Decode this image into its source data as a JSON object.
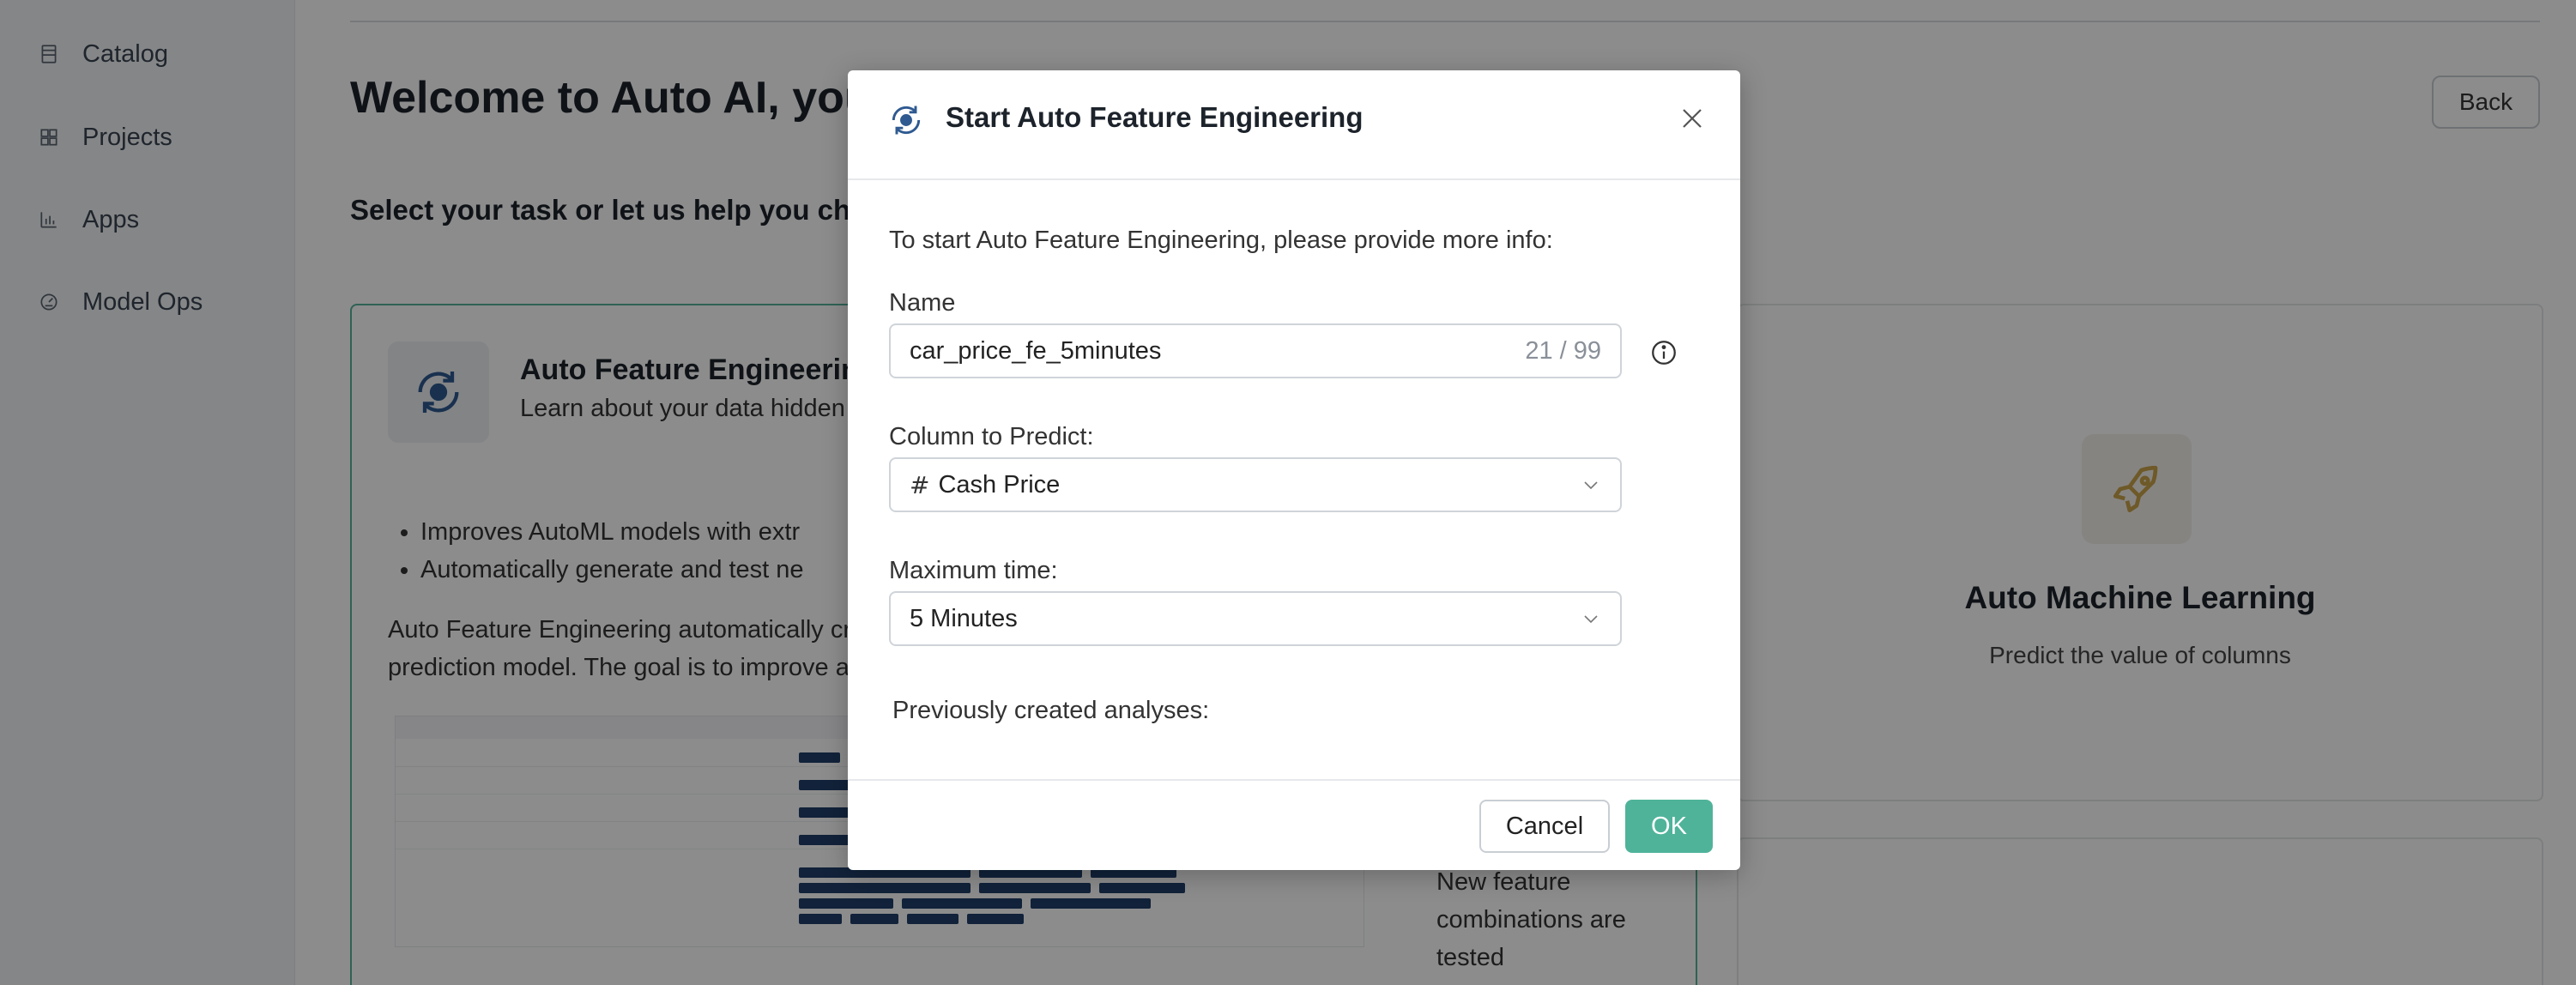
{
  "sidebar": {
    "items": [
      {
        "label": "Catalog",
        "icon": "catalog-icon"
      },
      {
        "label": "Projects",
        "icon": "grid-icon"
      },
      {
        "label": "Apps",
        "icon": "bar-chart-icon"
      },
      {
        "label": "Model Ops",
        "icon": "gauge-icon"
      }
    ]
  },
  "header": {
    "title": "Welcome to Auto AI, your",
    "back_label": "Back",
    "subtitle": "Select your task or let us help you cho"
  },
  "card_fe": {
    "title": "Auto Feature Engineering",
    "description": "Learn about your data hidden",
    "bullets": [
      "Improves AutoML models with extr",
      "Automatically generate and test ne"
    ],
    "paragraph_line1": "Auto Feature Engineering automatically cr",
    "paragraph_line2": "prediction model. The goal is to improve a",
    "right_bullet": "New feature combinations are tested"
  },
  "card_aml": {
    "title": "Auto Machine Learning",
    "description": "Predict the value of columns",
    "icon": "rocket-icon",
    "accent": "#c9a24a"
  },
  "modal": {
    "title": "Start Auto Feature Engineering",
    "intro": "To start Auto Feature Engineering, please provide more info:",
    "name_label": "Name",
    "name_value": "car_price_fe_5minutes",
    "name_count": "21 / 99",
    "column_label": "Column to Predict:",
    "column_value": "Cash Price",
    "max_time_label": "Maximum time:",
    "max_time_value": "5 Minutes",
    "previous_label": "Previously created analyses:",
    "cancel_label": "Cancel",
    "ok_label": "OK",
    "ok_color": "#4fb39a"
  }
}
